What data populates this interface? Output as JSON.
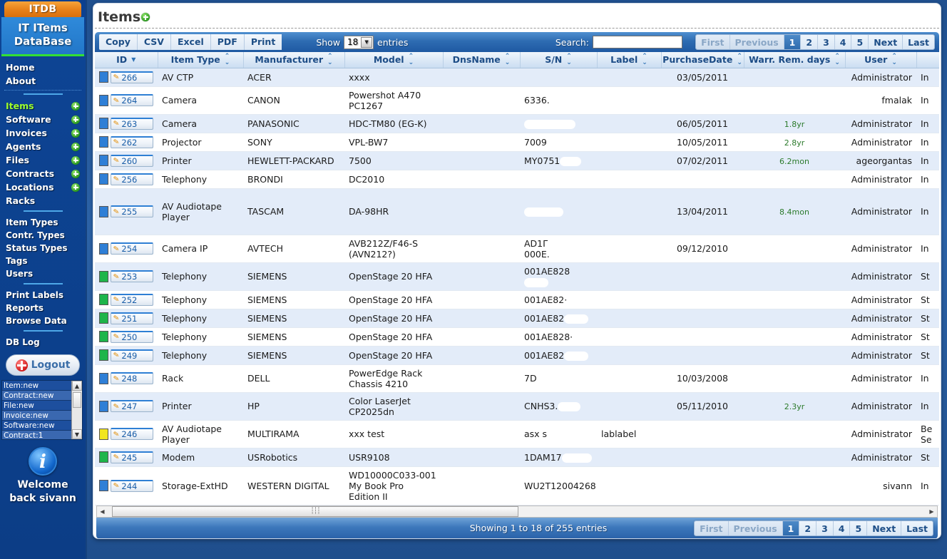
{
  "sidebar": {
    "logo": "ITDB",
    "title_line1": "IT ITems",
    "title_line2": "DataBase",
    "nav_top": [
      {
        "label": "Home",
        "plus": false
      },
      {
        "label": "About",
        "plus": false
      }
    ],
    "nav_main": [
      {
        "label": "Items",
        "plus": true,
        "active": true
      },
      {
        "label": "Software",
        "plus": true,
        "active": false
      },
      {
        "label": "Invoices",
        "plus": true,
        "active": false
      },
      {
        "label": "Agents",
        "plus": true,
        "active": false
      },
      {
        "label": "Files",
        "plus": true,
        "active": false
      },
      {
        "label": "Contracts",
        "plus": true,
        "active": false
      },
      {
        "label": "Locations",
        "plus": true,
        "active": false
      },
      {
        "label": "Racks",
        "plus": false,
        "active": false
      }
    ],
    "nav_types": [
      {
        "label": "Item Types"
      },
      {
        "label": "Contr. Types"
      },
      {
        "label": "Status Types"
      },
      {
        "label": "Tags"
      },
      {
        "label": "Users"
      }
    ],
    "nav_tools": [
      {
        "label": "Print Labels"
      },
      {
        "label": "Reports"
      },
      {
        "label": "Browse Data"
      }
    ],
    "nav_log": [
      {
        "label": "DB Log"
      }
    ],
    "logout_label": "Logout",
    "db_log_items": [
      "Item:new",
      "Contract:new",
      "File:new",
      "Invoice:new",
      "Software:new",
      "Contract:1"
    ],
    "welcome_line1": "Welcome",
    "welcome_line2": "back sivann"
  },
  "header": {
    "title": "Items",
    "add_icon": "plus-circle-icon"
  },
  "toolbar": {
    "export_buttons": [
      "Copy",
      "CSV",
      "Excel",
      "PDF",
      "Print"
    ],
    "show_label": "Show",
    "entries_label": "entries",
    "page_length": "18",
    "search_label": "Search:",
    "search_value": "",
    "search_placeholder": ""
  },
  "pagination": {
    "first": "First",
    "previous": "Previous",
    "pages": [
      "1",
      "2",
      "3",
      "4",
      "5"
    ],
    "active_page": "1",
    "next": "Next",
    "last": "Last"
  },
  "table": {
    "columns": [
      {
        "label": "ID",
        "sort": "desc"
      },
      {
        "label": "Item Type",
        "sort": "both"
      },
      {
        "label": "Manufacturer",
        "sort": "both"
      },
      {
        "label": "Model",
        "sort": "both"
      },
      {
        "label": "DnsName",
        "sort": "both"
      },
      {
        "label": "S/N",
        "sort": "both"
      },
      {
        "label": "Label",
        "sort": "both"
      },
      {
        "label": "PurchaseDate",
        "sort": "both"
      },
      {
        "label": "Warr. Rem. days",
        "sort": "both"
      },
      {
        "label": "User",
        "sort": "both"
      },
      {
        "label": "",
        "sort": "none"
      }
    ],
    "rows": [
      {
        "status_color": "#2f7fd6",
        "id": "266",
        "item_type": "AV CTP",
        "manufacturer": "ACER",
        "model": "xxxx",
        "dnsname": "",
        "sn": "",
        "sn_redact": 0,
        "label": "",
        "purchase_date": "03/05/2011",
        "warranty": "",
        "user": "Administrator",
        "state": "In"
      },
      {
        "status_color": "#2f7fd6",
        "id": "264",
        "item_type": "Camera",
        "manufacturer": "CANON",
        "model": "Powershot A470\nPC1267",
        "dnsname": "",
        "sn": "6336.",
        "sn_redact": 0,
        "label": "",
        "purchase_date": "",
        "warranty": "",
        "user": "fmalak",
        "state": "In"
      },
      {
        "status_color": "#2f7fd6",
        "id": "263",
        "item_type": "Camera",
        "manufacturer": "PANASONIC",
        "model": "HDC-TM80 (EG-K)",
        "dnsname": "",
        "sn": "",
        "sn_redact": 72,
        "label": "",
        "purchase_date": "06/05/2011",
        "warranty": "1.8yr",
        "user": "Administrator",
        "state": "In"
      },
      {
        "status_color": "#2f7fd6",
        "id": "262",
        "item_type": "Projector",
        "manufacturer": "SONY",
        "model": "VPL-BW7",
        "dnsname": "",
        "sn": "7009",
        "sn_redact": 0,
        "label": "",
        "purchase_date": "10/05/2011",
        "warranty": "2.8yr",
        "user": "Administrator",
        "state": "In"
      },
      {
        "status_color": "#2f7fd6",
        "id": "260",
        "item_type": "Printer",
        "manufacturer": "HEWLETT-PACKARD",
        "model": "7500",
        "dnsname": "",
        "sn": "MY0751",
        "sn_redact": 30,
        "label": "",
        "purchase_date": "07/02/2011",
        "warranty": "6.2mon",
        "user": "ageorgantas",
        "state": "In"
      },
      {
        "status_color": "#2f7fd6",
        "id": "256",
        "item_type": "Telephony",
        "manufacturer": "BRONDI",
        "model": "DC2010",
        "dnsname": "",
        "sn": "",
        "sn_redact": 0,
        "label": "",
        "purchase_date": "",
        "warranty": "",
        "user": "Administrator",
        "state": "In"
      },
      {
        "status_color": "#2f7fd6",
        "id": "255",
        "item_type": "AV Audiotape\nPlayer",
        "manufacturer": "TASCAM",
        "model": "DA-98HR",
        "dnsname": "",
        "sn": "",
        "sn_redact": 55,
        "label": "",
        "purchase_date": "13/04/2011",
        "warranty": "8.4mon",
        "user": "Administrator",
        "state": "In",
        "tall": 65
      },
      {
        "status_color": "#2f7fd6",
        "id": "254",
        "item_type": "Camera IP",
        "manufacturer": "AVTECH",
        "model": "AVB212Z/F46-S\n(AVN212?)",
        "dnsname": "",
        "sn": "AD1Γ\n000E.",
        "sn_redact": 0,
        "label": "",
        "purchase_date": "09/12/2010",
        "warranty": "",
        "user": "Administrator",
        "state": "In"
      },
      {
        "status_color": "#1eb54a",
        "id": "253",
        "item_type": "Telephony",
        "manufacturer": "SIEMENS",
        "model": "OpenStage 20 HFA",
        "dnsname": "",
        "sn": "001AE828",
        "sn_redact": 34,
        "label": "",
        "purchase_date": "",
        "warranty": "",
        "user": "Administrator",
        "state": "St"
      },
      {
        "status_color": "#1eb54a",
        "id": "252",
        "item_type": "Telephony",
        "manufacturer": "SIEMENS",
        "model": "OpenStage 20 HFA",
        "dnsname": "",
        "sn": "001AE82·",
        "sn_redact": 0,
        "label": "",
        "purchase_date": "",
        "warranty": "",
        "user": "Administrator",
        "state": "St"
      },
      {
        "status_color": "#1eb54a",
        "id": "251",
        "item_type": "Telephony",
        "manufacturer": "SIEMENS",
        "model": "OpenStage 20 HFA",
        "dnsname": "",
        "sn": "001AE82",
        "sn_redact": 34,
        "label": "",
        "purchase_date": "",
        "warranty": "",
        "user": "Administrator",
        "state": "St"
      },
      {
        "status_color": "#1eb54a",
        "id": "250",
        "item_type": "Telephony",
        "manufacturer": "SIEMENS",
        "model": "OpenStage 20 HFA",
        "dnsname": "",
        "sn": "001AE828·",
        "sn_redact": 0,
        "label": "",
        "purchase_date": "",
        "warranty": "",
        "user": "Administrator",
        "state": "St"
      },
      {
        "status_color": "#1eb54a",
        "id": "249",
        "item_type": "Telephony",
        "manufacturer": "SIEMENS",
        "model": "OpenStage 20 HFA",
        "dnsname": "",
        "sn": "001AE82",
        "sn_redact": 34,
        "label": "",
        "purchase_date": "",
        "warranty": "",
        "user": "Administrator",
        "state": "St"
      },
      {
        "status_color": "#2f7fd6",
        "id": "248",
        "item_type": "Rack",
        "manufacturer": "DELL",
        "model": "PowerEdge Rack\nChassis 4210",
        "dnsname": "",
        "sn": "7D",
        "sn_redact": 0,
        "label": "",
        "purchase_date": "10/03/2008",
        "warranty": "",
        "user": "Administrator",
        "state": "In"
      },
      {
        "status_color": "#2f7fd6",
        "id": "247",
        "item_type": "Printer",
        "manufacturer": "HP",
        "model": "Color LaserJet\nCP2025dn",
        "dnsname": "",
        "sn": "CNHS3.",
        "sn_redact": 32,
        "label": "",
        "purchase_date": "05/11/2010",
        "warranty": "2.3yr",
        "user": "Administrator",
        "state": "In"
      },
      {
        "status_color": "#f2e61e",
        "id": "246",
        "item_type": "AV Audiotape\nPlayer",
        "manufacturer": "MULTIRAMA",
        "model": "xxx test",
        "dnsname": "",
        "sn": "asx s",
        "sn_redact": 0,
        "label": "lablabel",
        "purchase_date": "",
        "warranty": "",
        "user": "Administrator",
        "state": "Be\nSe"
      },
      {
        "status_color": "#1eb54a",
        "id": "245",
        "item_type": "Modem",
        "manufacturer": "USRobotics",
        "model": "USR9108",
        "dnsname": "",
        "sn": "1DAM17",
        "sn_redact": 42,
        "label": "",
        "purchase_date": "",
        "warranty": "",
        "user": "Administrator",
        "state": "St"
      },
      {
        "status_color": "#2f7fd6",
        "id": "244",
        "item_type": "Storage-ExtHD",
        "manufacturer": "WESTERN DIGITAL",
        "model": "WD10000C033-001\nMy Book Pro\nEdition II",
        "dnsname": "",
        "sn": "WU2T12004268",
        "sn_redact": 0,
        "label": "",
        "purchase_date": "",
        "warranty": "",
        "user": "sivann",
        "state": "In"
      }
    ]
  },
  "footer": {
    "info": "Showing 1 to 18 of 255 entries"
  }
}
